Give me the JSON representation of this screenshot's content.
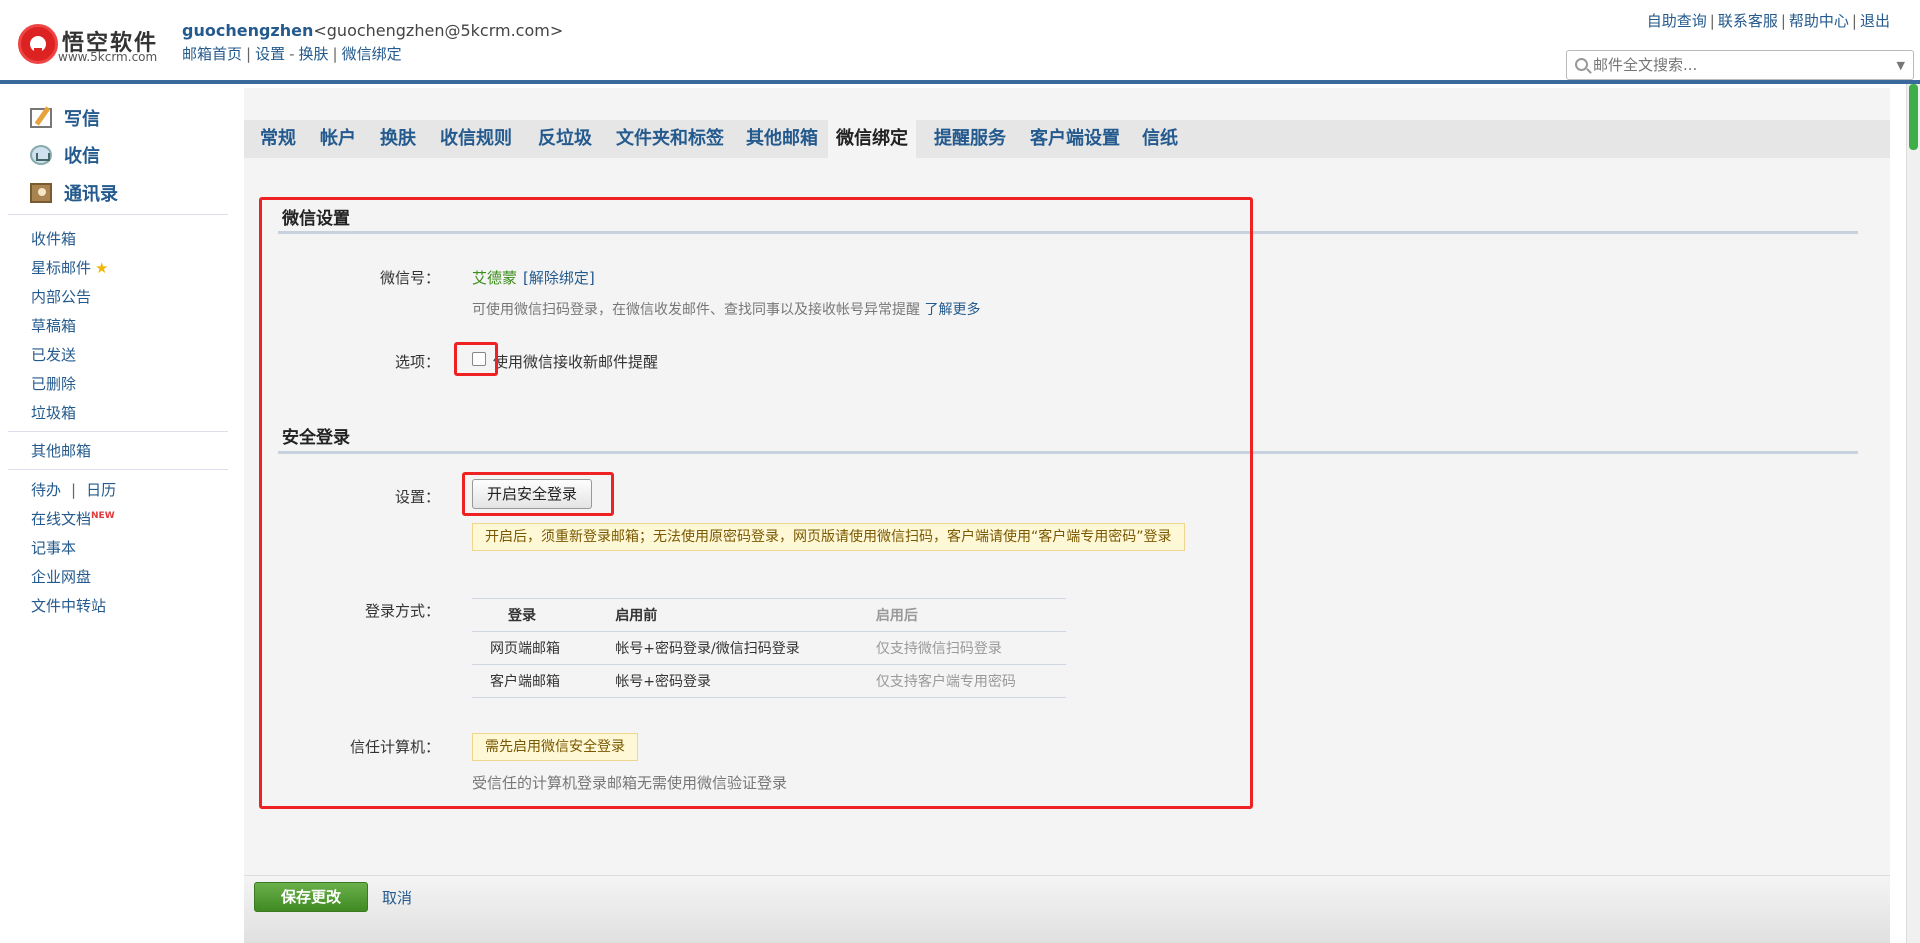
{
  "header": {
    "logo_name": "悟空软件",
    "logo_url": "www.5kcrm.com",
    "user_name": "guochengzhen",
    "user_email": "<guochengzhen@5kcrm.com>",
    "sub_nav": [
      "邮箱首页",
      "设置",
      "换肤",
      "微信绑定"
    ],
    "top_links": [
      "自助查询",
      "联系客服",
      "帮助中心",
      "退出"
    ],
    "search_placeholder": "邮件全文搜索..."
  },
  "sidebar": {
    "primary": [
      "写信",
      "收信",
      "通讯录"
    ],
    "folders": [
      "收件箱",
      "星标邮件",
      "内部公告",
      "草稿箱",
      "已发送",
      "已删除",
      "垃圾箱"
    ],
    "other_mail": "其他邮箱",
    "tools": {
      "todo": "待办",
      "calendar": "日历",
      "online_docs": "在线文档",
      "new_badge": "NEW",
      "notes": "记事本",
      "netdisk": "企业网盘",
      "transfer": "文件中转站"
    }
  },
  "tabs": [
    "常规",
    "帐户",
    "换肤",
    "收信规则",
    "反垃圾",
    "文件夹和标签",
    "其他邮箱",
    "微信绑定",
    "提醒服务",
    "客户端设置",
    "信纸"
  ],
  "active_tab": "微信绑定",
  "wechat": {
    "title": "微信设置",
    "id_label": "微信号：",
    "id_value": "艾德蒙",
    "unbind": "[解除绑定]",
    "hint": "可使用微信扫码登录，在微信收发邮件、查找同事以及接收帐号异常提醒",
    "learn_more": "了解更多",
    "option_label": "选项：",
    "option_text": "使用微信接收新邮件提醒",
    "option_checked": false
  },
  "secure_login": {
    "title": "安全登录",
    "setting_label": "设置：",
    "button": "开启安全登录",
    "notice": "开启后，须重新登录邮箱；无法使用原密码登录，网页版请使用微信扫码，客户端请使用“客户端专用密码”登录",
    "mode_label": "登录方式：",
    "table": {
      "headers": [
        "登录",
        "启用前",
        "启用后"
      ],
      "rows": [
        [
          "网页端邮箱",
          "帐号+密码登录/微信扫码登录",
          "仅支持微信扫码登录"
        ],
        [
          "客户端邮箱",
          "帐号+密码登录",
          "仅支持客户端专用密码"
        ]
      ]
    },
    "trusted_label": "信任计算机：",
    "trusted_badge": "需先启用微信安全登录",
    "trusted_hint": "受信任的计算机登录邮箱无需使用微信验证登录"
  },
  "footer": {
    "save": "保存更改",
    "cancel": "取消"
  },
  "colors": {
    "link": "#245a8d",
    "accent_green": "#3f8a22",
    "highlight_red": "#e22222",
    "header_rule": "#3a6a9c"
  }
}
